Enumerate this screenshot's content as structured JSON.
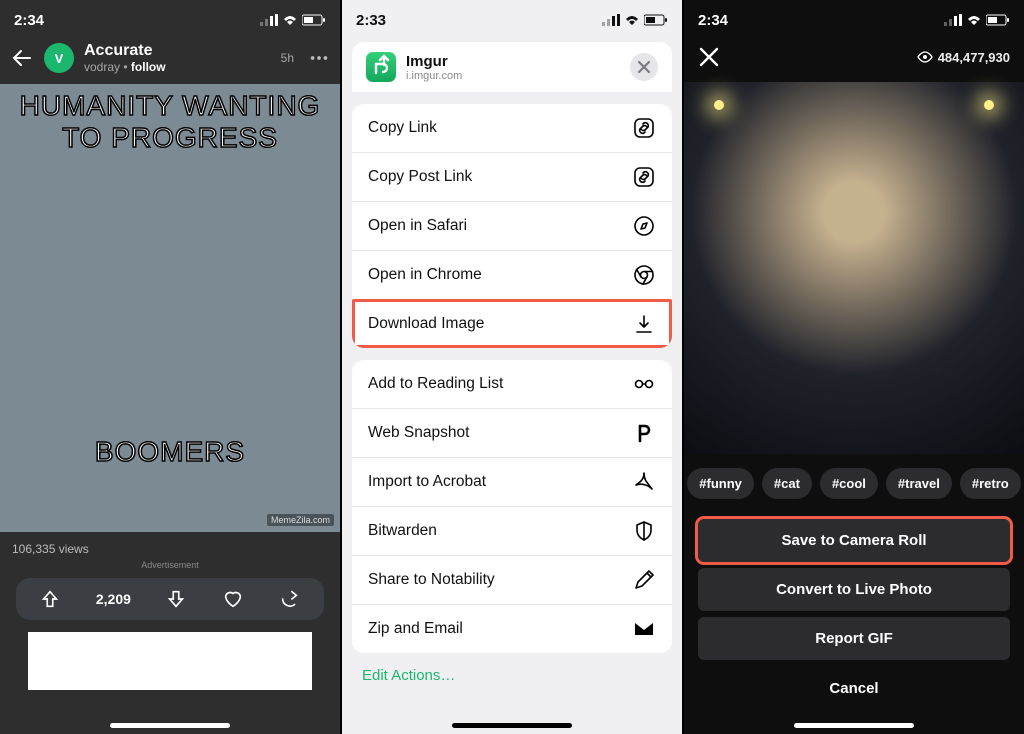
{
  "panel1": {
    "time": "2:34",
    "post_title": "Accurate",
    "author": "vodray",
    "follow": "follow",
    "age": "5h",
    "meme_top": "HUMANITY WANTING TO PROGRESS",
    "meme_bottom": "BOOMERS",
    "watermark": "MemeZila.com",
    "views": "106,335 views",
    "ad_label": "Advertisement",
    "upvote_count": "2,209"
  },
  "panel2": {
    "time": "2:33",
    "app_name": "Imgur",
    "app_domain": "i.imgur.com",
    "actions_a": [
      {
        "label": "Copy Link",
        "icon": "link-square"
      },
      {
        "label": "Copy Post Link",
        "icon": "link-square"
      },
      {
        "label": "Open in Safari",
        "icon": "compass"
      },
      {
        "label": "Open in Chrome",
        "icon": "chrome"
      },
      {
        "label": "Download Image",
        "icon": "download",
        "highlight": true
      }
    ],
    "actions_b": [
      {
        "label": "Add to Reading List",
        "icon": "glasses"
      },
      {
        "label": "Web Snapshot",
        "icon": "p-letter"
      },
      {
        "label": "Import to Acrobat",
        "icon": "acrobat"
      },
      {
        "label": "Bitwarden",
        "icon": "shield"
      },
      {
        "label": "Share to Notability",
        "icon": "pencil"
      },
      {
        "label": "Zip and Email",
        "icon": "mail"
      }
    ],
    "edit": "Edit Actions…"
  },
  "panel3": {
    "time": "2:34",
    "view_count": "484,477,930",
    "tags": [
      "#funny",
      "#cat",
      "#cool",
      "#travel",
      "#retro"
    ],
    "buttons": [
      {
        "label": "Save to Camera Roll",
        "highlight": true
      },
      {
        "label": "Convert to Live Photo"
      },
      {
        "label": "Report GIF"
      }
    ],
    "cancel": "Cancel"
  }
}
